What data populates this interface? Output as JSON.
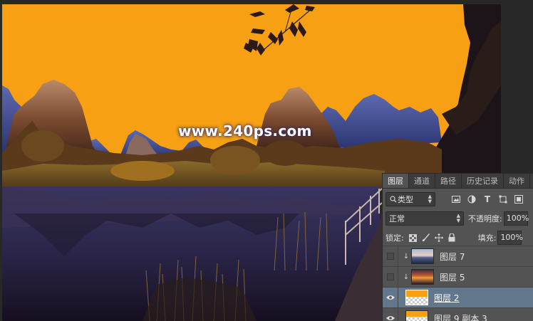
{
  "watermark": {
    "text": "www.240ps.com"
  },
  "panel": {
    "tabs": [
      {
        "label": "图层",
        "active": true
      },
      {
        "label": "通道"
      },
      {
        "label": "路径"
      },
      {
        "label": "历史记录"
      },
      {
        "label": "动作"
      }
    ],
    "filter": {
      "label": "类型",
      "search_icon": "search-icon"
    },
    "filter_icons": [
      "image-filter-icon",
      "adjustment-filter-icon",
      "type-filter-icon",
      "shape-filter-icon",
      "smart-object-filter-icon"
    ],
    "blend_mode": "正常",
    "opacity_label": "不透明度:",
    "opacity_value": "100%",
    "lock_label": "锁定:",
    "lock_icons": [
      "lock-transparent-icon",
      "lock-paint-icon",
      "lock-move-icon",
      "lock-all-icon"
    ],
    "fill_label": "填充:",
    "fill_value": "100%",
    "layers": [
      {
        "name": "图层 7",
        "visible": false,
        "clipped": true,
        "selected": false
      },
      {
        "name": "图层 5",
        "visible": false,
        "clipped": true,
        "selected": false
      },
      {
        "name": "图层 2",
        "visible": true,
        "clipped": false,
        "selected": true
      },
      {
        "name": "图层 9 副本 3",
        "visible": true,
        "clipped": false,
        "selected": false
      }
    ]
  },
  "colors": {
    "sky": "#f7a013",
    "panel_bg": "#535353",
    "selected_layer": "#62768c"
  }
}
